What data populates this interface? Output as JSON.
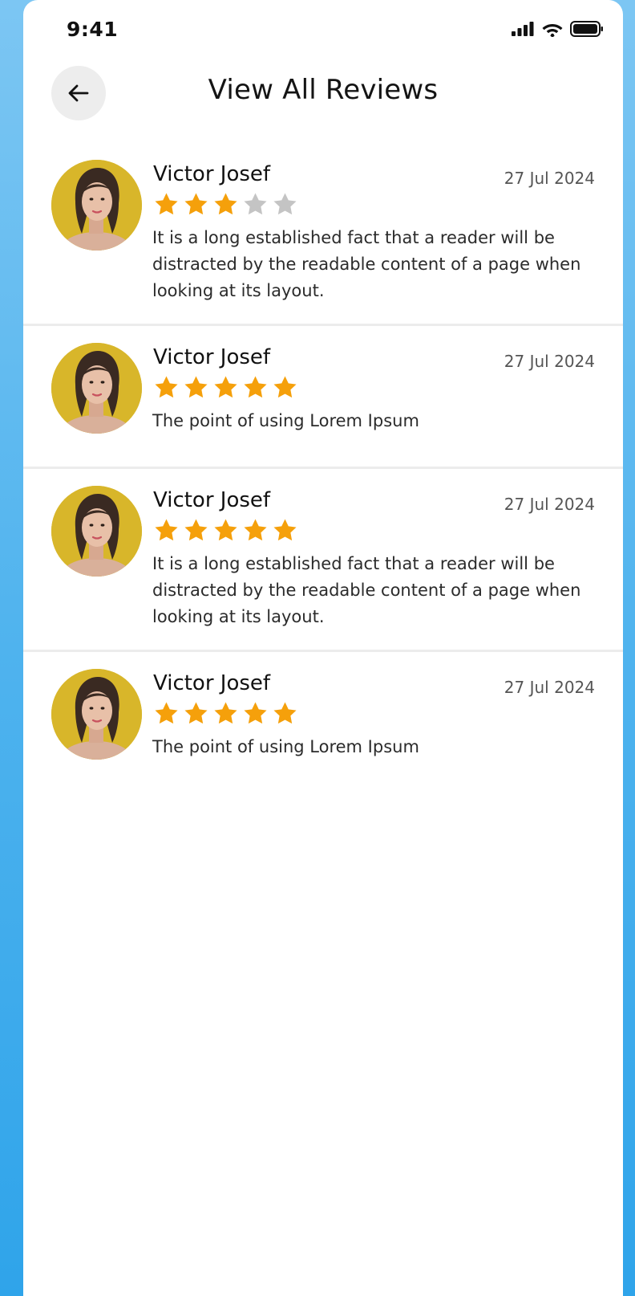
{
  "status_bar": {
    "time": "9:41",
    "icons": [
      "cellular-signal-icon",
      "wifi-icon",
      "battery-icon"
    ]
  },
  "header": {
    "back_icon": "arrow-left-icon",
    "title": "View All Reviews"
  },
  "colors": {
    "star_filled": "#f5a00b",
    "star_empty": "#c4c4c4",
    "avatar_background": "#d8b62a",
    "page_background": "#4fb3ee"
  },
  "reviews": [
    {
      "name": "Victor Josef",
      "date": "27 Jul 2024",
      "rating": 3,
      "max_rating": 5,
      "text": "It is a long established fact that a reader will be distracted by the readable content of a page when looking at its layout."
    },
    {
      "name": "Victor Josef",
      "date": "27 Jul 2024",
      "rating": 5,
      "max_rating": 5,
      "text": "The point of using Lorem Ipsum"
    },
    {
      "name": "Victor Josef",
      "date": "27 Jul 2024",
      "rating": 5,
      "max_rating": 5,
      "text": "It is a long established fact that a reader will be distracted by the readable content of a page when looking at its layout."
    },
    {
      "name": "Victor Josef",
      "date": "27 Jul 2024",
      "rating": 5,
      "max_rating": 5,
      "text": "The point of using Lorem Ipsum"
    }
  ]
}
